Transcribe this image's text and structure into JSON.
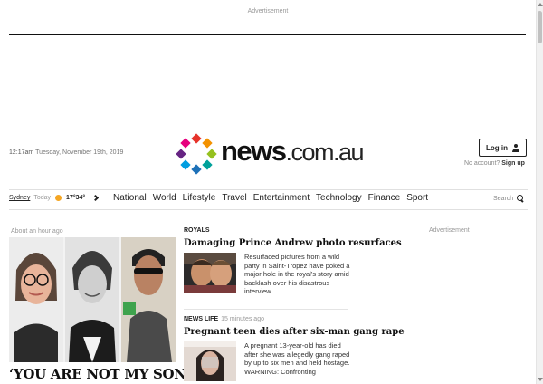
{
  "ads": {
    "top_label": "Advertisement",
    "right_label": "Advertisement"
  },
  "header": {
    "time": "12:17am",
    "date": "Tuesday, November 19th, 2019",
    "logo_main": "news",
    "logo_suffix": ".com.au",
    "login_label": "Log in",
    "no_account": "No account?",
    "signup_label": "Sign up"
  },
  "weather": {
    "city": "Sydney",
    "day": "Today",
    "temps": "17°34°"
  },
  "nav": {
    "items": [
      "National",
      "World",
      "Lifestyle",
      "Travel",
      "Entertainment",
      "Technology",
      "Finance",
      "Sport"
    ],
    "search_label": "Search"
  },
  "lead": {
    "time_ago": "About an hour ago",
    "headline": "‘YOU ARE NOT MY SON’:"
  },
  "stories": [
    {
      "kicker": "ROYALS",
      "time_ago": "",
      "headline": "Damaging Prince Andrew photo resurfaces",
      "blurb": "Resurfaced pictures from a wild party in Saint-Tropez have poked a major hole in the royal’s story amid backlash over his disastrous interview."
    },
    {
      "kicker": "NEWS LIFE",
      "time_ago": "15 minutes ago",
      "headline": "Pregnant teen dies after six-man gang rape",
      "blurb": "A pregnant 13-year-old has died after she was allegedly gang raped by up to six men and held hostage. WARNING: Confronting"
    }
  ],
  "colors": {
    "accent": "#111111",
    "logo_dots": [
      "#e6332a",
      "#f39200",
      "#95c11f",
      "#009ee0",
      "#1d71b8",
      "#662483",
      "#e6007e",
      "#00a19a"
    ]
  }
}
